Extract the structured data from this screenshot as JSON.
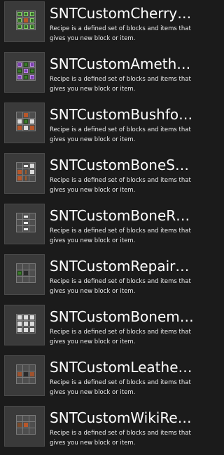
{
  "recipes": [
    {
      "title": "SNTCustomCherry…",
      "description": "Recipe is a defined set of blocks and items that gives you new block or item.",
      "icon": "crafting-grid-icon"
    },
    {
      "title": "SNTCustomAmeth…",
      "description": "Recipe is a defined set of blocks and items that gives you new block or item.",
      "icon": "crafting-grid-icon"
    },
    {
      "title": "SNTCustomBushfo…",
      "description": "Recipe is a defined set of blocks and items that gives you new block or item.",
      "icon": "crafting-grid-icon"
    },
    {
      "title": "SNTCustomBoneS…",
      "description": "Recipe is a defined set of blocks and items that gives you new block or item.",
      "icon": "crafting-grid-icon"
    },
    {
      "title": "SNTCustomBoneR…",
      "description": "Recipe is a defined set of blocks and items that gives you new block or item.",
      "icon": "crafting-grid-icon"
    },
    {
      "title": "SNTCustomRepair…",
      "description": "Recipe is a defined set of blocks and items that gives you new block or item.",
      "icon": "crafting-grid-icon"
    },
    {
      "title": "SNTCustomBonem…",
      "description": "Recipe is a defined set of blocks and items that gives you new block or item.",
      "icon": "crafting-grid-icon"
    },
    {
      "title": "SNTCustomLeathe…",
      "description": "Recipe is a defined set of blocks and items that gives you new block or item.",
      "icon": "crafting-grid-icon"
    },
    {
      "title": "SNTCustomWikiRe…",
      "description": "Recipe is a defined set of blocks and items that gives you new block or item.",
      "icon": "crafting-grid-icon"
    }
  ],
  "colors": {
    "background": "#1b1b1b",
    "thumb": "#3a3a3a",
    "text": "#ffffff"
  }
}
